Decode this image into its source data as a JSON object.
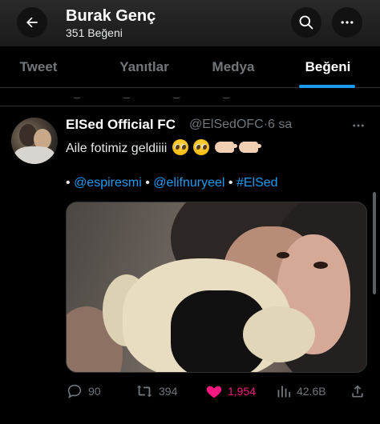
{
  "header": {
    "title": "Burak Genç",
    "subtitle": "351 Beğeni"
  },
  "tabs": [
    {
      "label": "Tweet",
      "active": false
    },
    {
      "label": "Yanıtlar",
      "active": false
    },
    {
      "label": "Medya",
      "active": false
    },
    {
      "label": "Beğeni",
      "active": true
    }
  ],
  "tweet": {
    "author_name": "ElSed Official FC",
    "author_handle": "@ElSedOFC",
    "separator": "·",
    "time": "6 sa",
    "text": "Aile fotimiz geldiiii",
    "emojis": [
      "pleading-face",
      "pleading-face",
      "pinching-hand",
      "pinching-hand"
    ],
    "bullet": "•",
    "links": [
      "@espiresmi",
      "@elifnuryeel",
      "#ElSed"
    ],
    "stats": {
      "replies": "90",
      "retweets": "394",
      "likes": "1,954",
      "views": "42.6B"
    }
  },
  "icons": {
    "back": "arrow-left-icon",
    "search": "search-icon",
    "more": "more-horizontal-icon",
    "reply": "reply-icon",
    "retweet": "retweet-icon",
    "like": "heart-filled-icon",
    "views": "views-chart-icon",
    "share": "share-icon"
  },
  "colors": {
    "accent": "#1d9bf0",
    "like": "#f91880",
    "muted": "#71767b",
    "background": "#000000"
  }
}
